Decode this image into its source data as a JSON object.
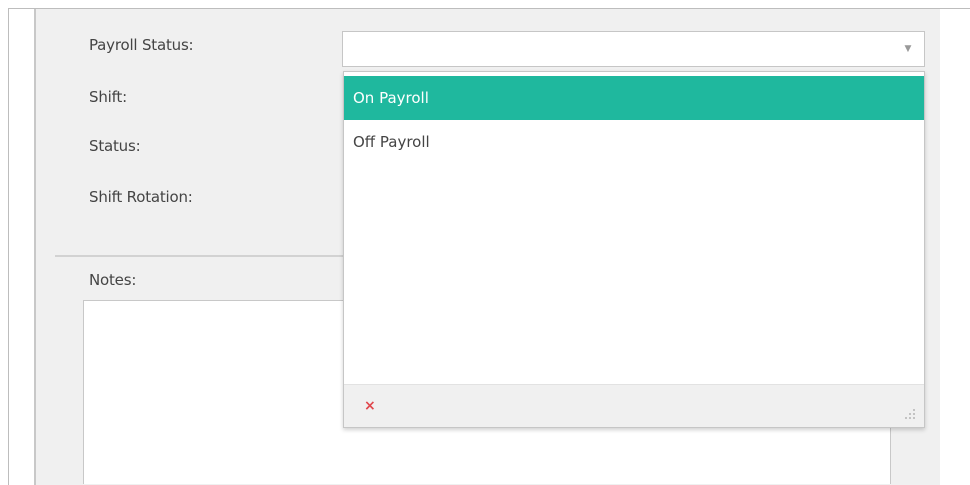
{
  "form": {
    "payroll_status_label": "Payroll Status:",
    "shift_label": "Shift:",
    "status_label": "Status:",
    "shift_rotation_label": "Shift Rotation:",
    "notes_label": "Notes:"
  },
  "payroll_select": {
    "value": "",
    "arrow_icon": "chevron-down-icon"
  },
  "dropdown": {
    "options": [
      {
        "label": "On Payroll",
        "selected": true
      },
      {
        "label": "Off Payroll",
        "selected": false
      }
    ],
    "clear_icon": "×",
    "resize_icon": "resize-grip-icon"
  },
  "colors": {
    "accent": "#1fb89e",
    "clear": "#e0474c",
    "panel": "#f0f0f0"
  }
}
